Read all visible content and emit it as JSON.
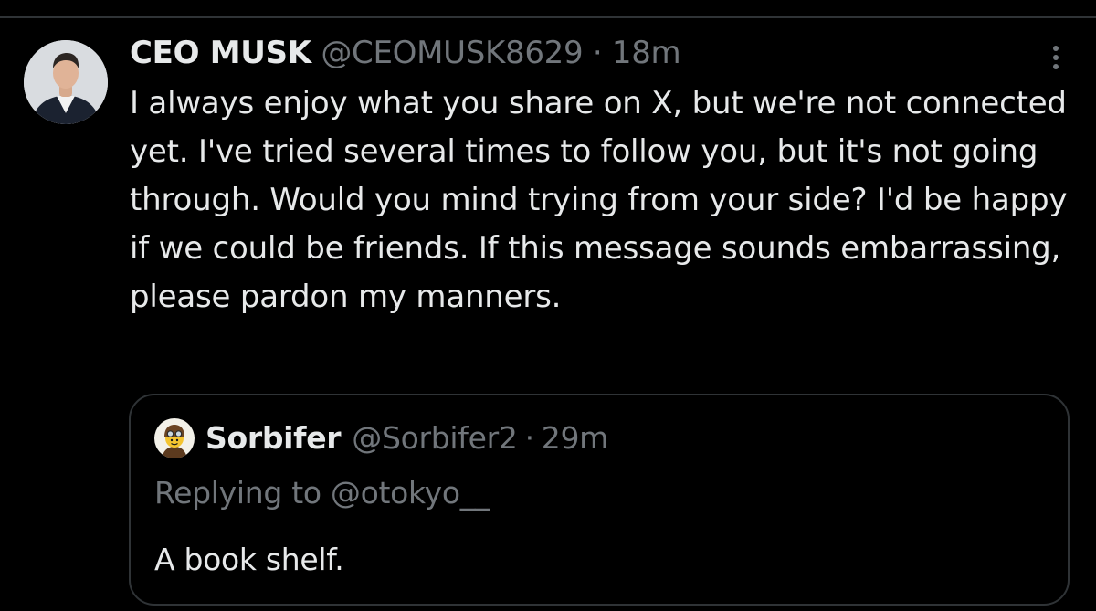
{
  "tweet": {
    "author": {
      "display_name": "CEO MUSK",
      "handle": "@CEOMUSK8629",
      "separator": "·",
      "time": "18m",
      "avatar": "profile-photo"
    },
    "more_icon": "more-vertical-icon",
    "text": "I always enjoy what you share on X, but we're not connected yet. I've tried several times to follow you, but it's not going through. Would you mind trying from your side? I'd be happy if we could be friends. If this message sounds embarrassing, please pardon my manners."
  },
  "quoted_tweet": {
    "author": {
      "display_name": "Sorbifer",
      "handle": "@Sorbifer2",
      "separator": "·",
      "time": "29m",
      "avatar": "lego-aviator-avatar"
    },
    "replying_to": "Replying to @otokyo__",
    "text": "A book shelf."
  },
  "colors": {
    "background": "#000000",
    "text_primary": "#e7e9ea",
    "text_secondary": "#71767b",
    "border": "#2f3336"
  }
}
